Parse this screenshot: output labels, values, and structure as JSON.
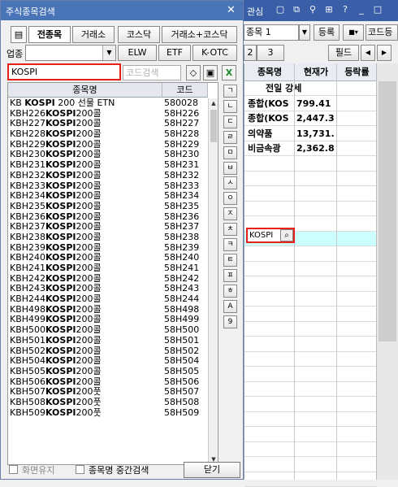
{
  "background": {
    "title_tab": "관심",
    "combo_value": "종목 1",
    "register_label": "등록",
    "code_label": "코드등",
    "page_tabs": [
      "2",
      "3"
    ],
    "field_label": "필드",
    "grid_headers": [
      "종목명",
      "현재가",
      "등락률"
    ],
    "grid_rows": [
      {
        "name": "전일 강세",
        "price": ""
      },
      {
        "name": "종합(KOS",
        "price": "799.41"
      },
      {
        "name": "종합(KOS",
        "price": "2,447.3"
      },
      {
        "name": "의약품",
        "price": "13,731."
      },
      {
        "name": "비금속광",
        "price": "2,362.8"
      }
    ],
    "search_box_value": "KOSPI",
    "highlight_color": "#ccffff"
  },
  "dialog": {
    "title": "주식종목검색",
    "close_icon": "close-icon",
    "tabs": [
      "전종목",
      "거래소",
      "코스닥",
      "거래소+코스닥"
    ],
    "sector_label": "업종",
    "filter_tabs": [
      "ELW",
      "ETF",
      "K-OTC"
    ],
    "search_value": "KOSPI",
    "code_placeholder": "코드검색",
    "list_headers": [
      "종목명",
      "코드"
    ],
    "list_rows": [
      {
        "pre": "KB ",
        "hl": "KOSPI",
        "post": " 200 선물 ETN",
        "code": "580028"
      },
      {
        "pre": "KBH226",
        "hl": "KOSPI",
        "post": "200콜",
        "code": "58H226"
      },
      {
        "pre": "KBH227",
        "hl": "KOSPI",
        "post": "200콜",
        "code": "58H227"
      },
      {
        "pre": "KBH228",
        "hl": "KOSPI",
        "post": "200콜",
        "code": "58H228"
      },
      {
        "pre": "KBH229",
        "hl": "KOSPI",
        "post": "200콜",
        "code": "58H229"
      },
      {
        "pre": "KBH230",
        "hl": "KOSPI",
        "post": "200콜",
        "code": "58H230"
      },
      {
        "pre": "KBH231",
        "hl": "KOSPI",
        "post": "200콜",
        "code": "58H231"
      },
      {
        "pre": "KBH232",
        "hl": "KOSPI",
        "post": "200콜",
        "code": "58H232"
      },
      {
        "pre": "KBH233",
        "hl": "KOSPI",
        "post": "200콜",
        "code": "58H233"
      },
      {
        "pre": "KBH234",
        "hl": "KOSPI",
        "post": "200콜",
        "code": "58H234"
      },
      {
        "pre": "KBH235",
        "hl": "KOSPI",
        "post": "200콜",
        "code": "58H235"
      },
      {
        "pre": "KBH236",
        "hl": "KOSPI",
        "post": "200콜",
        "code": "58H236"
      },
      {
        "pre": "KBH237",
        "hl": "KOSPI",
        "post": "200콜",
        "code": "58H237"
      },
      {
        "pre": "KBH238",
        "hl": "KOSPI",
        "post": "200콜",
        "code": "58H238"
      },
      {
        "pre": "KBH239",
        "hl": "KOSPI",
        "post": "200콜",
        "code": "58H239"
      },
      {
        "pre": "KBH240",
        "hl": "KOSPI",
        "post": "200콜",
        "code": "58H240"
      },
      {
        "pre": "KBH241",
        "hl": "KOSPI",
        "post": "200콜",
        "code": "58H241"
      },
      {
        "pre": "KBH242",
        "hl": "KOSPI",
        "post": "200콜",
        "code": "58H242"
      },
      {
        "pre": "KBH243",
        "hl": "KOSPI",
        "post": "200콜",
        "code": "58H243"
      },
      {
        "pre": "KBH244",
        "hl": "KOSPI",
        "post": "200콜",
        "code": "58H244"
      },
      {
        "pre": "KBH498",
        "hl": "KOSPI",
        "post": "200콜",
        "code": "58H498"
      },
      {
        "pre": "KBH499",
        "hl": "KOSPI",
        "post": "200콜",
        "code": "58H499"
      },
      {
        "pre": "KBH500",
        "hl": "KOSPI",
        "post": "200콜",
        "code": "58H500"
      },
      {
        "pre": "KBH501",
        "hl": "KOSPI",
        "post": "200콜",
        "code": "58H501"
      },
      {
        "pre": "KBH502",
        "hl": "KOSPI",
        "post": "200콜",
        "code": "58H502"
      },
      {
        "pre": "KBH504",
        "hl": "KOSPI",
        "post": "200콜",
        "code": "58H504"
      },
      {
        "pre": "KBH505",
        "hl": "KOSPI",
        "post": "200콜",
        "code": "58H505"
      },
      {
        "pre": "KBH506",
        "hl": "KOSPI",
        "post": "200콜",
        "code": "58H506"
      },
      {
        "pre": "KBH507",
        "hl": "KOSPI",
        "post": "200풋",
        "code": "58H507"
      },
      {
        "pre": "KBH508",
        "hl": "KOSPI",
        "post": "200풋",
        "code": "58H508"
      },
      {
        "pre": "KBH509",
        "hl": "KOSPI",
        "post": "200풋",
        "code": "58H509"
      }
    ],
    "consonants": [
      "ㄱ",
      "ㄴ",
      "ㄷ",
      "ㄹ",
      "ㅁ",
      "ㅂ",
      "ㅅ",
      "ㅇ",
      "ㅈ",
      "ㅊ",
      "ㅋ",
      "ㅌ",
      "ㅍ",
      "ㅎ",
      "A",
      "9"
    ],
    "keep_screen_label": "화면유지",
    "middle_search_label": "종목명 중간검색",
    "close_button_label": "닫기",
    "accent_color": "#4a74b8",
    "highlight_border_color": "#e8201a"
  }
}
